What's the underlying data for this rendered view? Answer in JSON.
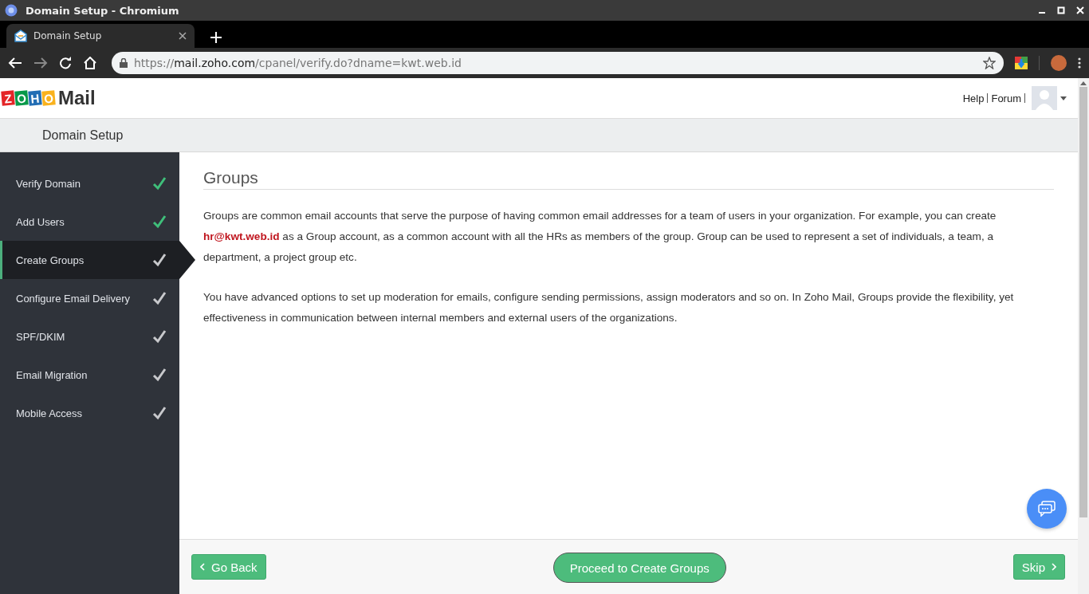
{
  "window": {
    "title": "Domain Setup - Chromium"
  },
  "tabs": [
    {
      "label": "Domain Setup",
      "selected": true
    }
  ],
  "address_bar": {
    "scheme": "https://",
    "host": "mail.zoho.com",
    "path": "/cpanel/verify.do?dname=kwt.web.id"
  },
  "logo": {
    "letters": [
      "Z",
      "O",
      "H",
      "O"
    ],
    "product": "Mail"
  },
  "header_links": [
    "Help",
    "Forum"
  ],
  "page_title": "Domain Setup",
  "steps": [
    {
      "label": "Verify Domain",
      "done": true,
      "selected": false
    },
    {
      "label": "Add Users",
      "done": true,
      "selected": false
    },
    {
      "label": "Create Groups",
      "done": false,
      "selected": true
    },
    {
      "label": "Configure Email Delivery",
      "done": false,
      "selected": false
    },
    {
      "label": "SPF/DKIM",
      "done": false,
      "selected": false
    },
    {
      "label": "Email Migration",
      "done": false,
      "selected": false
    },
    {
      "label": "Mobile Access",
      "done": false,
      "selected": false
    }
  ],
  "section_title": "Groups",
  "paragraphs": [
    "Groups are common email accounts that serve the purpose of having common email addresses for a team of users in your organization. For example, you can create **hr@kwt.web.id** as a Group account, as a common account with all the HRs as members of the group. Group can be used to represent a set of individuals, a team, a department, a project group etc.",
    "You have advanced options to set up moderation for emails, configure sending permissions, assign moderators and so on. In Zoho Mail, Groups provide the flexibility, yet effectiveness in communication between internal members and external users of the organizations."
  ],
  "buttons": {
    "back": "Go Back",
    "proceed": "Proceed to Create Groups",
    "skip": "Skip"
  }
}
